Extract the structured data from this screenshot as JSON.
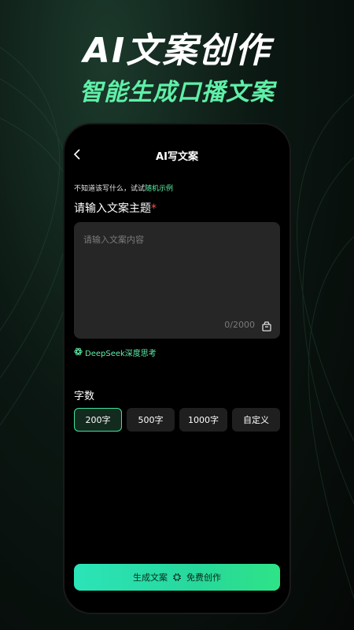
{
  "promo": {
    "title": "AI文案创作",
    "subtitle": "智能生成口播文案"
  },
  "nav": {
    "back_icon": "chevron-left-icon",
    "title": "AI写文案"
  },
  "hint": {
    "prefix": "不知道该写什么，试试",
    "link": "随机示例"
  },
  "topic": {
    "label": "请输入文案主题",
    "required_mark": "*",
    "placeholder": "请输入文案内容",
    "counter": "0/2000",
    "clear_icon": "trash-basket-icon"
  },
  "deepseek": {
    "label": "DeepSeek深度思考",
    "icon": "atom-icon"
  },
  "word_count": {
    "label": "字数",
    "options": [
      "200字",
      "500字",
      "1000字",
      "自定义"
    ],
    "selected": "200字"
  },
  "cta": {
    "label": "生成文案",
    "icon": "chip-icon",
    "sub_label": "免费创作"
  },
  "colors": {
    "accent": "#5ff0a8",
    "required": "#ff4d4f",
    "input_bg": "#262626",
    "option_bg": "#1f1f1f"
  }
}
